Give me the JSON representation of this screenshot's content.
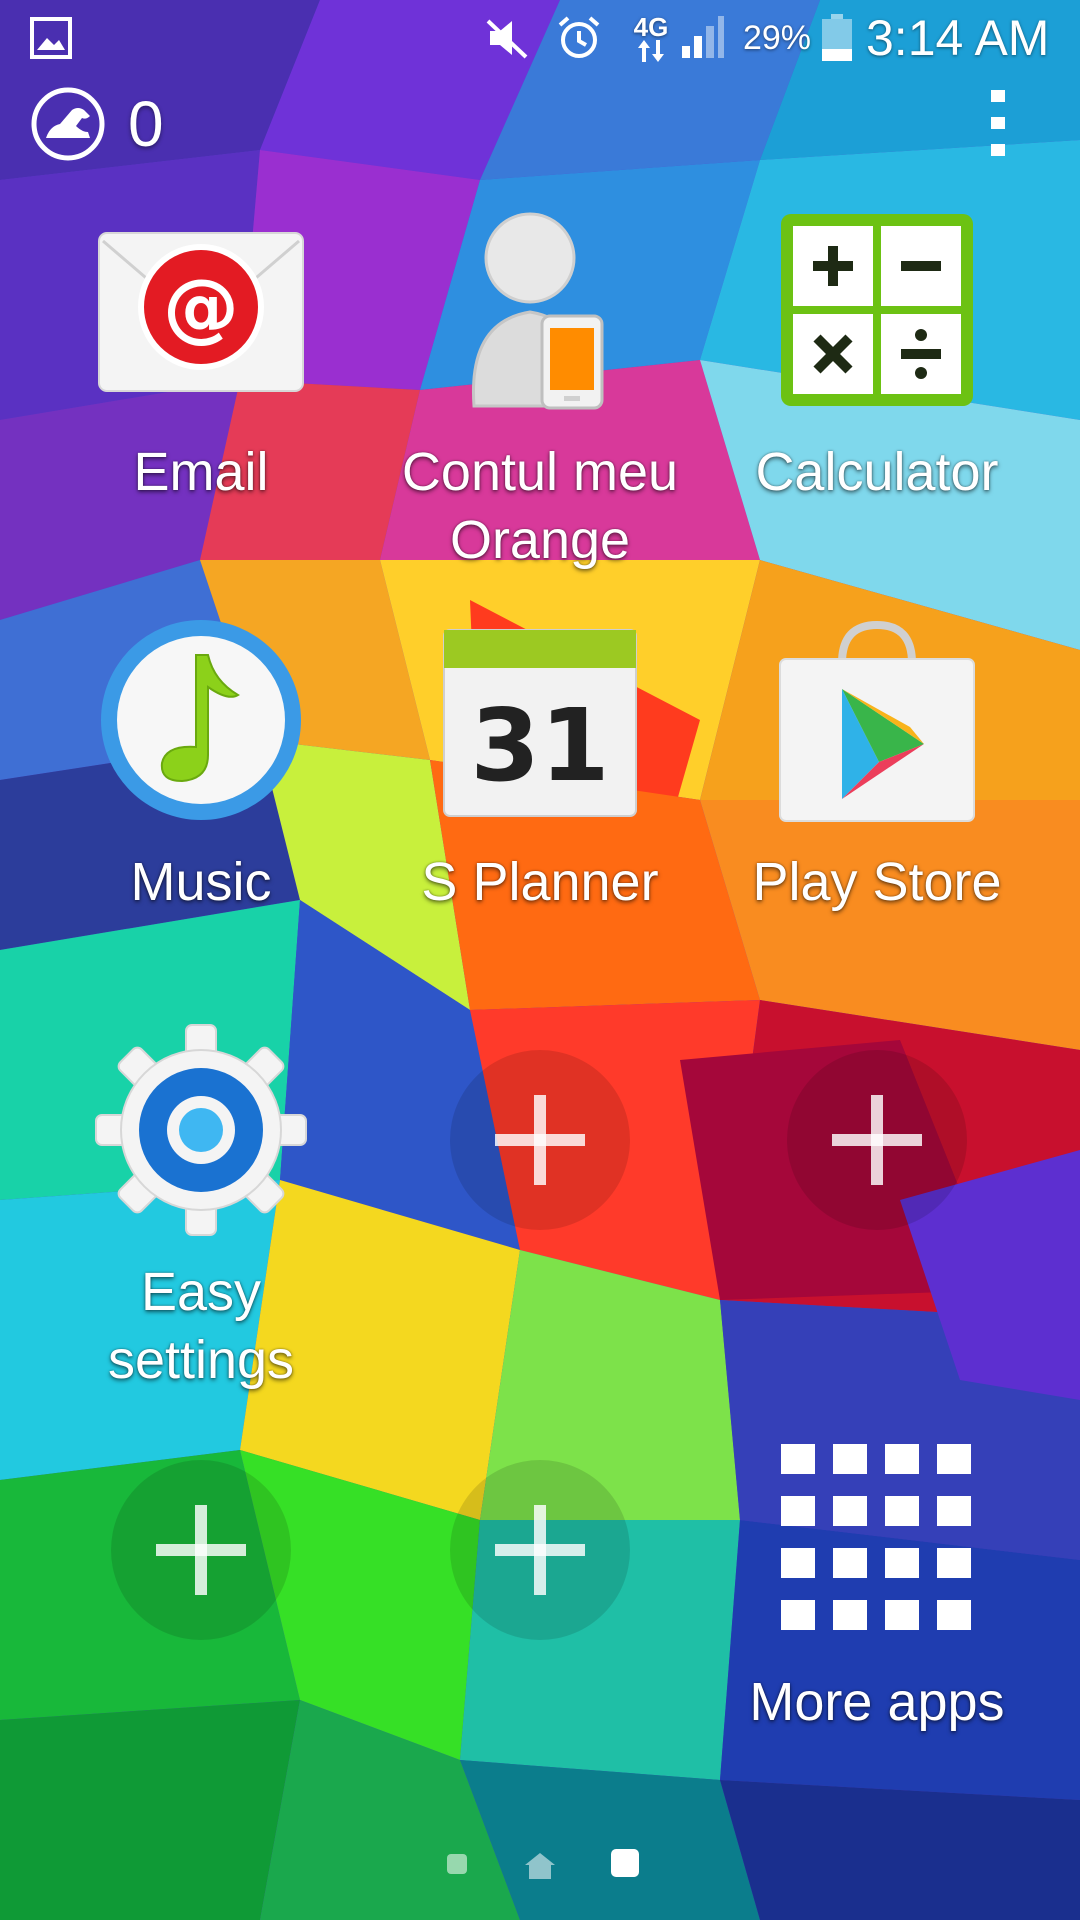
{
  "status_bar": {
    "gallery_icon": "image-icon",
    "mute_icon": "vibrate-muted-icon",
    "alarm_icon": "alarm-icon",
    "network_label": "4G",
    "battery_percent": "29%",
    "battery_level": 0.29,
    "time": "3:14 AM"
  },
  "pedometer": {
    "icon": "shoe-icon",
    "count": "0"
  },
  "apps": [
    {
      "id": "email",
      "label": "Email",
      "label2": "",
      "icon": "email-icon"
    },
    {
      "id": "contul-meu-orange",
      "label": "Contul meu",
      "label2": "Orange",
      "icon": "account-icon"
    },
    {
      "id": "calculator",
      "label": "Calculator",
      "label2": "",
      "icon": "calculator-icon"
    },
    {
      "id": "music",
      "label": "Music",
      "label2": "",
      "icon": "music-icon"
    },
    {
      "id": "s-planner",
      "label": "S Planner",
      "label2": "",
      "icon": "calendar-icon",
      "date": "31"
    },
    {
      "id": "play-store",
      "label": "Play Store",
      "label2": "",
      "icon": "play-store-icon"
    },
    {
      "id": "easy-settings",
      "label": "Easy",
      "label2": "settings",
      "icon": "settings-gear-icon"
    },
    {
      "id": "more-apps",
      "label": "More apps",
      "label2": "",
      "icon": "apps-grid-icon"
    }
  ],
  "page_indicator": {
    "pages": [
      "left-page",
      "home",
      "current-page"
    ],
    "current": 2
  },
  "colors": {
    "email_red": "#e31b23",
    "calculator_green": "#6cc213",
    "music_blue": "#3b9ae6",
    "planner_green": "#9cc922",
    "settings_blue": "#1a72d1"
  }
}
